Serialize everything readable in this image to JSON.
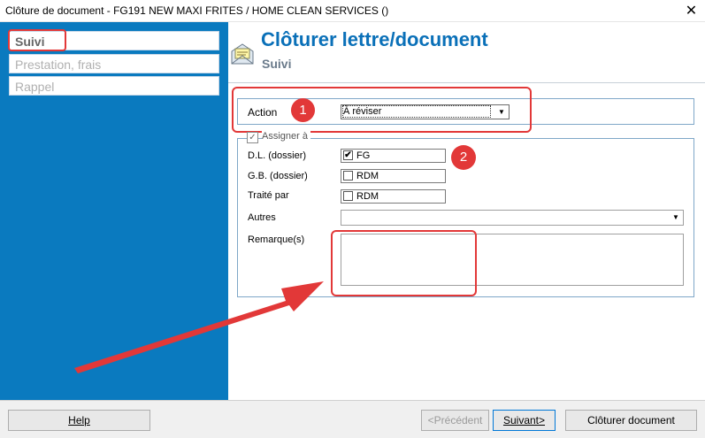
{
  "window": {
    "title": "Clôture de document - FG191 NEW MAXI FRITES / HOME CLEAN SERVICES ()",
    "close": "✕"
  },
  "sidebar": {
    "items": [
      {
        "label": "Suivi"
      },
      {
        "label": "Prestation, frais"
      },
      {
        "label": "Rappel"
      }
    ]
  },
  "header": {
    "title": "Clôturer lettre/document",
    "subtitle": "Suivi"
  },
  "form": {
    "action": {
      "label": "Action",
      "value": "À réviser"
    },
    "assign": {
      "label": "Assigner à",
      "dl": {
        "label": "D.L. (dossier)",
        "value": "FG",
        "checked": true
      },
      "gb": {
        "label": "G.B. (dossier)",
        "value": "RDM",
        "checked": false
      },
      "traite": {
        "label": "Traité par",
        "value": "RDM",
        "checked": false
      },
      "autres": {
        "label": "Autres",
        "value": ""
      },
      "remarques": {
        "label": "Remarque(s)",
        "value": ""
      }
    }
  },
  "annotations": {
    "badge1": "1",
    "badge2": "2",
    "color": "#e23838"
  },
  "buttons": {
    "help": "Help",
    "previous": "<Précédent",
    "next": "Suivant>",
    "close_doc": "Clôturer document"
  },
  "colors": {
    "sidebar": "#0a7abf",
    "title": "#0a70b8"
  }
}
